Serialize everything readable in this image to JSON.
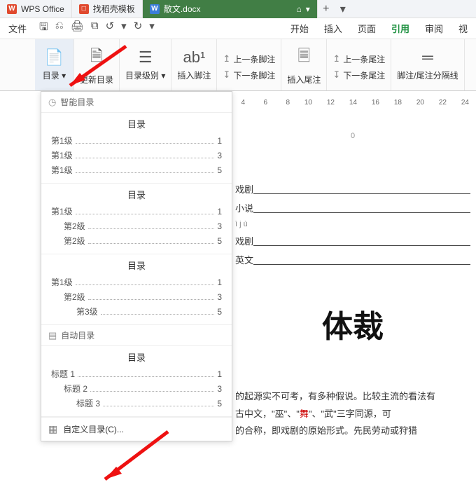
{
  "tabs": {
    "t1": {
      "icon_bg": "#e04a2f",
      "icon_txt": "W",
      "label": "WPS Office"
    },
    "t2": {
      "icon_bg": "#e04a2f",
      "icon_txt": "□",
      "label": "找稻壳模板"
    },
    "t3": {
      "icon_bg": "#3b7dd8",
      "icon_txt": "W",
      "label": "散文.docx",
      "device": "⌂",
      "dropdown": "▾"
    },
    "plus": "+",
    "more": "▾"
  },
  "menubar": {
    "file": "文件",
    "right": [
      "开始",
      "插入",
      "页面",
      "引用",
      "审阅",
      "视"
    ]
  },
  "quick_icons": [
    "🖫",
    "⎌",
    "🖨",
    "⧉",
    "↺",
    "▾",
    "↻",
    "▾"
  ],
  "ribbon": {
    "toc": {
      "label": "目录",
      "caret": "▾"
    },
    "update": "更新目录",
    "level": {
      "label": "目录级别",
      "caret": "▾"
    },
    "insert_footnote": "插入脚注",
    "prev_footnote": "上一条脚注",
    "next_footnote": "下一条脚注",
    "insert_endnote": "插入尾注",
    "prev_endnote": "上一条尾注",
    "next_endnote": "下一条尾注",
    "fn_sep": "脚注/尾注分隔线"
  },
  "ruler": [
    "4",
    "6",
    "8",
    "10",
    "12",
    "14",
    "16",
    "18",
    "20",
    "22",
    "24"
  ],
  "dropdown": {
    "smart": "智能目录",
    "auto": "自动目录",
    "custom": "自定义目录(C)...",
    "toc_title": "目录",
    "preset1": [
      {
        "lbl": "第1级",
        "pg": "1"
      },
      {
        "lbl": "第1级",
        "pg": "3"
      },
      {
        "lbl": "第1级",
        "pg": "5"
      }
    ],
    "preset2": [
      {
        "lbl": "第1级",
        "pg": "1",
        "ind": 0
      },
      {
        "lbl": "第2级",
        "pg": "3",
        "ind": 1
      },
      {
        "lbl": "第2级",
        "pg": "5",
        "ind": 1
      }
    ],
    "preset3": [
      {
        "lbl": "第1级",
        "pg": "1",
        "ind": 0
      },
      {
        "lbl": "第2级",
        "pg": "3",
        "ind": 1
      },
      {
        "lbl": "第3级",
        "pg": "5",
        "ind": 2
      }
    ],
    "preset4": [
      {
        "lbl": "标题 1",
        "pg": "1",
        "ind": 0
      },
      {
        "lbl": "标题 2",
        "pg": "3",
        "ind": 1
      },
      {
        "lbl": "标题 3",
        "pg": "5",
        "ind": 2
      }
    ]
  },
  "doc": {
    "pagenum": "0",
    "lines": [
      "戏剧",
      "小说",
      "ì j ù",
      "戏剧",
      "英文"
    ],
    "big_title": "体裁",
    "para": "的起源实不可考，有多种假说。比较主流的看法有",
    "para2a": "古中文，\"巫\"、\"",
    "para2_link": "舞",
    "para2b": "\"、\"武\"三字同源，可",
    "para3": "的合称，即戏剧的原始形式。先民劳动或狩猎"
  }
}
